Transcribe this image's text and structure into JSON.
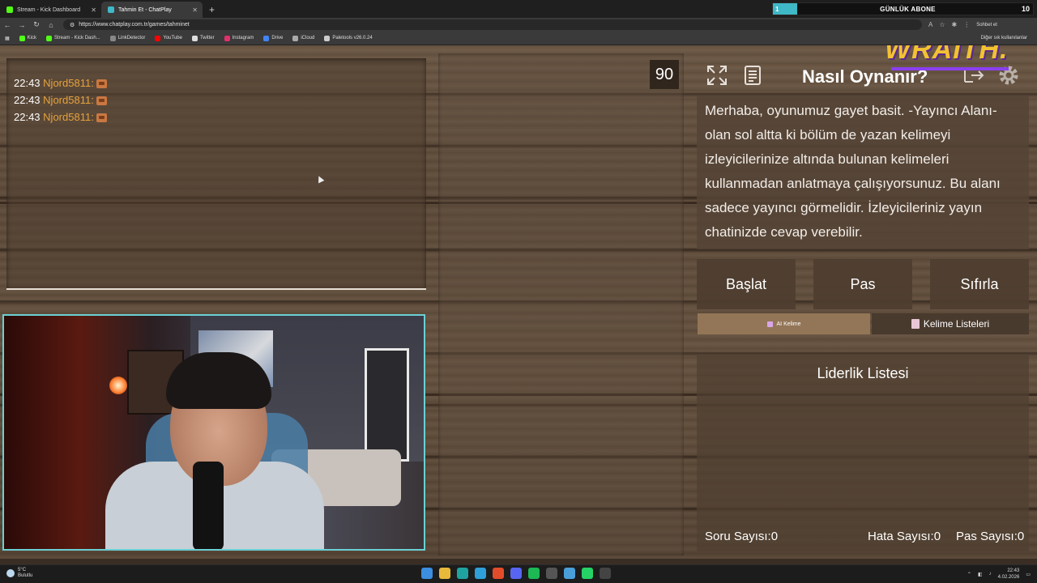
{
  "browser": {
    "tabs": [
      {
        "label": "Stream - Kick Dashboard",
        "active": false,
        "color": "#53fc18"
      },
      {
        "label": "Tahmin Et - ChatPlay",
        "active": true,
        "color": "#3fb8c7"
      }
    ],
    "url": "https://www.chatplay.com.tr/games/tahminet",
    "sohbet_label": "Sohbet et",
    "bookmarks": [
      {
        "label": "Kick",
        "color": "#53fc18"
      },
      {
        "label": "Stream - Kick Dash...",
        "color": "#53fc18"
      },
      {
        "label": "LinkDetector",
        "color": "#888888"
      },
      {
        "label": "YouTube",
        "color": "#ff0000"
      },
      {
        "label": "Twitter",
        "color": "#dddddd"
      },
      {
        "label": "Instagram",
        "color": "#e1306c"
      },
      {
        "label": "Drive",
        "color": "#4285f4"
      },
      {
        "label": "iCloud",
        "color": "#aaaaaa"
      },
      {
        "label": "Paletools v26.0.24",
        "color": "#cccccc"
      }
    ],
    "bookmarks_right": "Diğer sık kullanılanlar"
  },
  "subgoal": {
    "fill_label": "1",
    "title": "GÜNLÜK ABONE",
    "count": "10"
  },
  "overlay": {
    "streamer_logo": "WRAITH."
  },
  "chat": {
    "messages": [
      {
        "time": "22:43",
        "user": "Njord5811:"
      },
      {
        "time": "22:43",
        "user": "Njord5811:"
      },
      {
        "time": "22:43",
        "user": "Njord5811:"
      }
    ]
  },
  "game": {
    "timer": "90",
    "howto_title": "Nasıl Oynanır?",
    "howto_text": "Merhaba, oyunumuz gayet basit. -Yayıncı Alanı- olan sol altta ki bölüm de yazan kelimeyi izleyicilerinize altında bulunan kelimeleri kullanmadan anlatmaya çalışıyorsunuz. Bu alanı sadece yayıncı görmelidir. İzleyicileriniz yayın chatinizde cevap verebilir.",
    "buttons": {
      "start": "Başlat",
      "pass": "Pas",
      "reset": "Sıfırla"
    },
    "tabs": {
      "ai_word": "AI Kelime",
      "word_lists": "Kelime Listeleri"
    },
    "leaderboard": {
      "title": "Liderlik Listesi",
      "questions_label": "Soru Sayısı:",
      "questions_value": "0",
      "errors_label": "Hata Sayısı:",
      "errors_value": "0",
      "passes_label": "Pas Sayısı:",
      "passes_value": "0"
    }
  },
  "taskbar": {
    "weather_temp": "5°C",
    "weather_desc": "Bulutlu",
    "time": "22:43",
    "date": "4.02.2026"
  },
  "icons": [
    "expand-icon",
    "list-icon",
    "exit-icon",
    "gear-icon",
    "cursor-icon"
  ]
}
